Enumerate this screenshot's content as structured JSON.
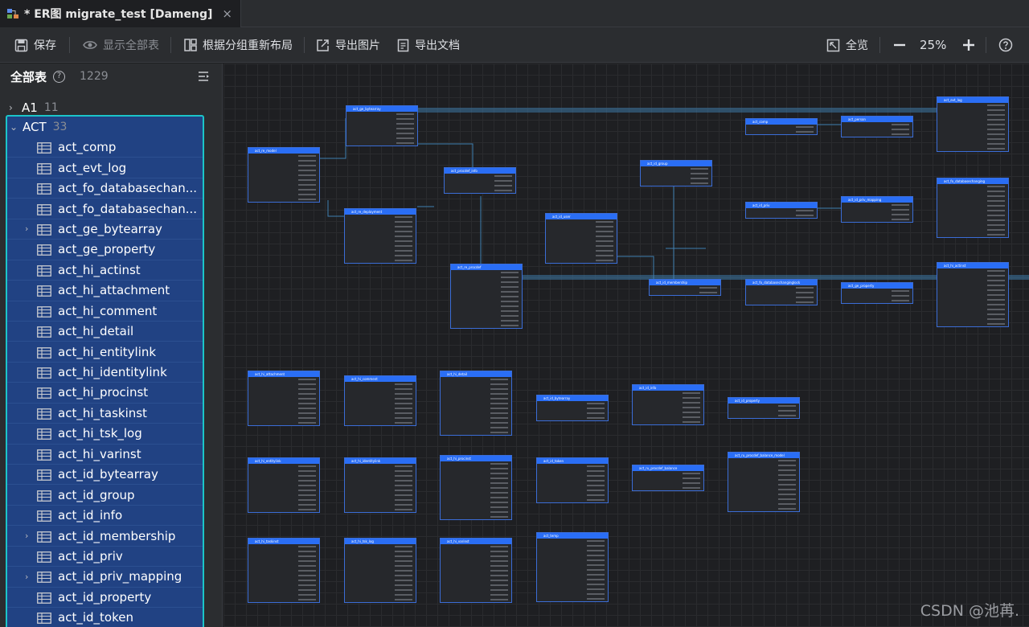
{
  "tab": {
    "title": "* ER图 migrate_test [Dameng]",
    "close": "×"
  },
  "toolbar": {
    "save": "保存",
    "show_all": "显示全部表",
    "relayout": "根据分组重新布局",
    "export_image": "导出图片",
    "export_doc": "导出文档",
    "overview": "全览",
    "zoom": "25%"
  },
  "sidebar": {
    "title": "全部表",
    "total": "1229",
    "groups": [
      {
        "name": "A1",
        "count": "11",
        "expanded": false
      },
      {
        "name": "ACT",
        "count": "33",
        "expanded": true
      }
    ],
    "tables": [
      {
        "name": "act_comp",
        "expandable": false
      },
      {
        "name": "act_evt_log",
        "expandable": false
      },
      {
        "name": "act_fo_databasechan...",
        "expandable": false
      },
      {
        "name": "act_fo_databasechan...",
        "expandable": false
      },
      {
        "name": "act_ge_bytearray",
        "expandable": true
      },
      {
        "name": "act_ge_property",
        "expandable": false
      },
      {
        "name": "act_hi_actinst",
        "expandable": false
      },
      {
        "name": "act_hi_attachment",
        "expandable": false
      },
      {
        "name": "act_hi_comment",
        "expandable": false
      },
      {
        "name": "act_hi_detail",
        "expandable": false
      },
      {
        "name": "act_hi_entitylink",
        "expandable": false
      },
      {
        "name": "act_hi_identitylink",
        "expandable": false
      },
      {
        "name": "act_hi_procinst",
        "expandable": false
      },
      {
        "name": "act_hi_taskinst",
        "expandable": false
      },
      {
        "name": "act_hi_tsk_log",
        "expandable": false
      },
      {
        "name": "act_hi_varinst",
        "expandable": false
      },
      {
        "name": "act_id_bytearray",
        "expandable": false
      },
      {
        "name": "act_id_group",
        "expandable": false
      },
      {
        "name": "act_id_info",
        "expandable": false
      },
      {
        "name": "act_id_membership",
        "expandable": true
      },
      {
        "name": "act_id_priv",
        "expandable": false
      },
      {
        "name": "act_id_priv_mapping",
        "expandable": true
      },
      {
        "name": "act_id_property",
        "expandable": false
      },
      {
        "name": "act_id_token",
        "expandable": false
      }
    ]
  },
  "er_tables": [
    {
      "name": "act_ge_bytearray",
      "rows": 7
    },
    {
      "name": "act_re_model",
      "rows": 10
    },
    {
      "name": "act_re_deployment",
      "rows": 10
    },
    {
      "name": "act_procdef_info",
      "rows": 4
    },
    {
      "name": "act_re_procdef",
      "rows": 12
    },
    {
      "name": "act_id_user",
      "rows": 9
    },
    {
      "name": "act_id_group",
      "rows": 4
    },
    {
      "name": "act_comp",
      "rows": 2
    },
    {
      "name": "act_person",
      "rows": 3
    },
    {
      "name": "act_evt_log",
      "rows": 10
    },
    {
      "name": "act_id_priv",
      "rows": 2
    },
    {
      "name": "act_id_priv_mapping",
      "rows": 4
    },
    {
      "name": "act_fo_databasechanging",
      "rows": 11
    },
    {
      "name": "act_id_membership",
      "rows": 2
    },
    {
      "name": "act_fo_databasechanginglock",
      "rows": 4
    },
    {
      "name": "act_ge_property",
      "rows": 3
    },
    {
      "name": "act_hi_actinst",
      "rows": 12
    },
    {
      "name": "act_hi_attachment",
      "rows": 10
    },
    {
      "name": "act_hi_comment",
      "rows": 9
    },
    {
      "name": "act_hi_detail",
      "rows": 12
    },
    {
      "name": "act_id_bytearray",
      "rows": 4
    },
    {
      "name": "act_id_info",
      "rows": 7
    },
    {
      "name": "act_id_property",
      "rows": 3
    },
    {
      "name": "act_hi_entitylink",
      "rows": 10
    },
    {
      "name": "act_hi_identitylink",
      "rows": 10
    },
    {
      "name": "act_hi_procinst",
      "rows": 12
    },
    {
      "name": "act_id_token",
      "rows": 8
    },
    {
      "name": "act_ru_procdef_balance",
      "rows": 4
    },
    {
      "name": "act_ru_procdef_balance_model",
      "rows": 11
    },
    {
      "name": "act_hi_taskinst",
      "rows": 12
    },
    {
      "name": "act_hi_tsk_log",
      "rows": 12
    },
    {
      "name": "act_hi_varinst",
      "rows": 12
    },
    {
      "name": "act_temp",
      "rows": 13
    }
  ],
  "watermark": "CSDN @池苒."
}
